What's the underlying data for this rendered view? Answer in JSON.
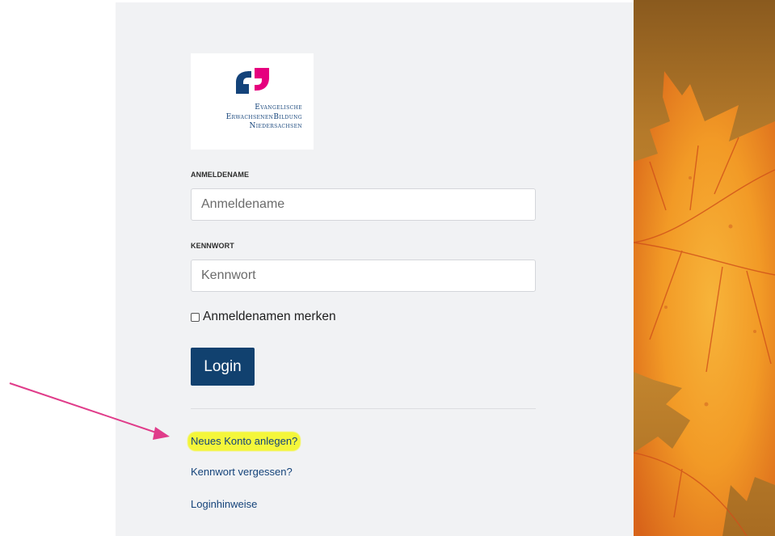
{
  "logo": {
    "line1": "Evangelische",
    "line2": "ErwachsenenBildung",
    "line3": "Niedersachsen"
  },
  "form": {
    "username_label": "ANMELDENAME",
    "username_placeholder": "Anmeldename",
    "username_value": "",
    "password_label": "KENNWORT",
    "password_placeholder": "Kennwort",
    "password_value": "",
    "remember_label": "Anmeldenamen merken",
    "remember_checked": false,
    "login_button": "Login"
  },
  "links": {
    "new_account": "Neues Konto anlegen?",
    "forgot_password": "Kennwort vergessen?",
    "login_hints": "Loginhinweise"
  },
  "colors": {
    "brand_blue": "#11416f",
    "brand_pink": "#e6007e",
    "annotation_arrow": "#e03c8a",
    "highlight": "#f4f63a"
  }
}
